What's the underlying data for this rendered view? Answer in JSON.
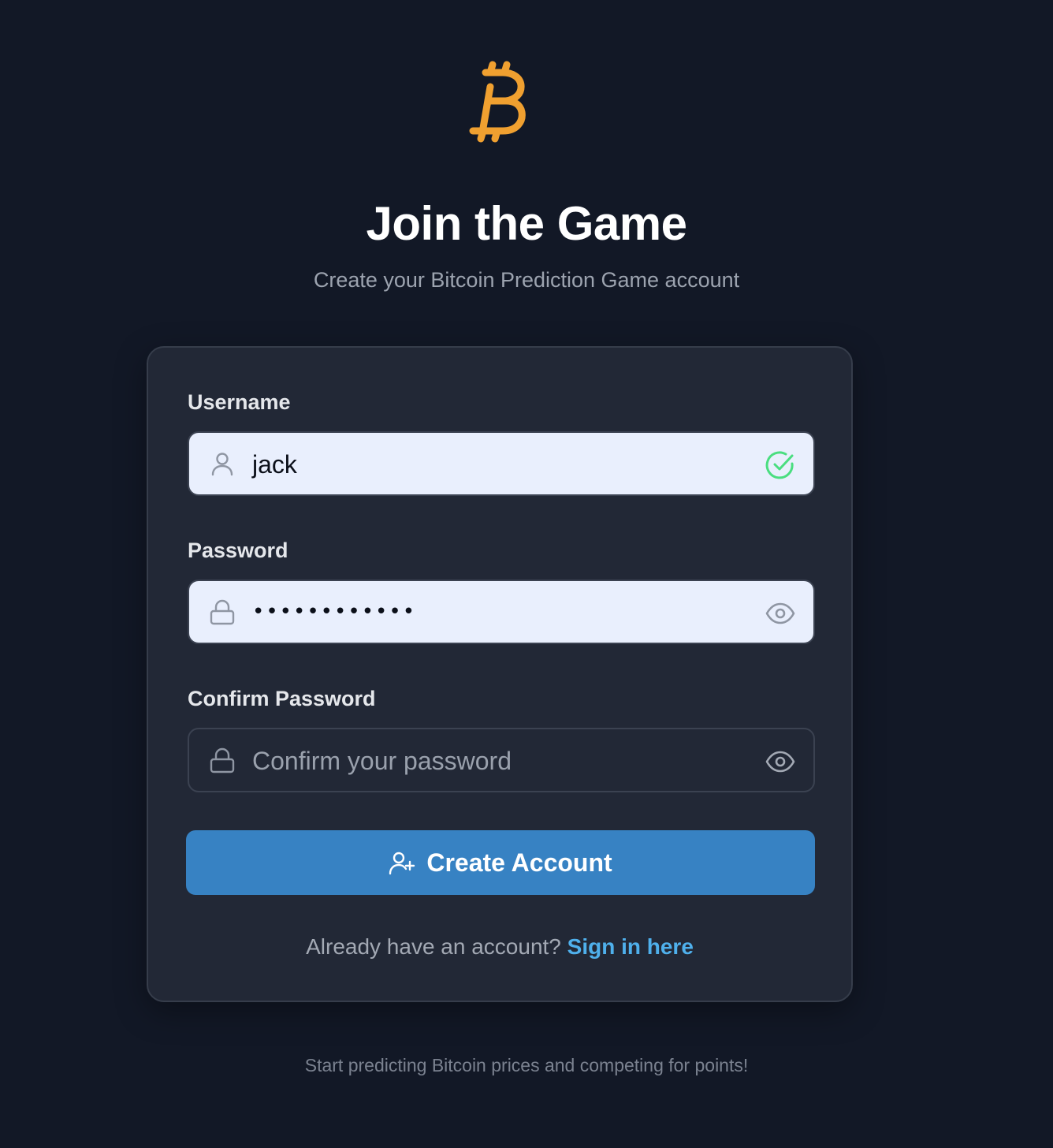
{
  "colors": {
    "background": "#121826",
    "card": "#222836",
    "accent_orange": "#f0a030",
    "button_blue": "#3782c3",
    "link_blue": "#4fb0ec",
    "valid_green": "#4ade80"
  },
  "logo": {
    "icon": "bitcoin-icon"
  },
  "header": {
    "title": "Join the Game",
    "subtitle": "Create your Bitcoin Prediction Game account"
  },
  "form": {
    "username": {
      "label": "Username",
      "value": "jack",
      "lead_icon": "user-icon",
      "trail_icon": "check-circle-icon"
    },
    "password": {
      "label": "Password",
      "value_masked": "••••••••••••",
      "lead_icon": "lock-icon",
      "trail_icon": "eye-icon"
    },
    "confirm_password": {
      "label": "Confirm Password",
      "placeholder": "Confirm your password",
      "lead_icon": "lock-icon",
      "trail_icon": "eye-icon"
    },
    "submit": {
      "label": "Create Account",
      "icon": "user-plus-icon"
    },
    "signin_prompt": {
      "text": "Already have an account?",
      "link": "Sign in here"
    }
  },
  "footer": {
    "text": "Start predicting Bitcoin prices and competing for points!"
  }
}
